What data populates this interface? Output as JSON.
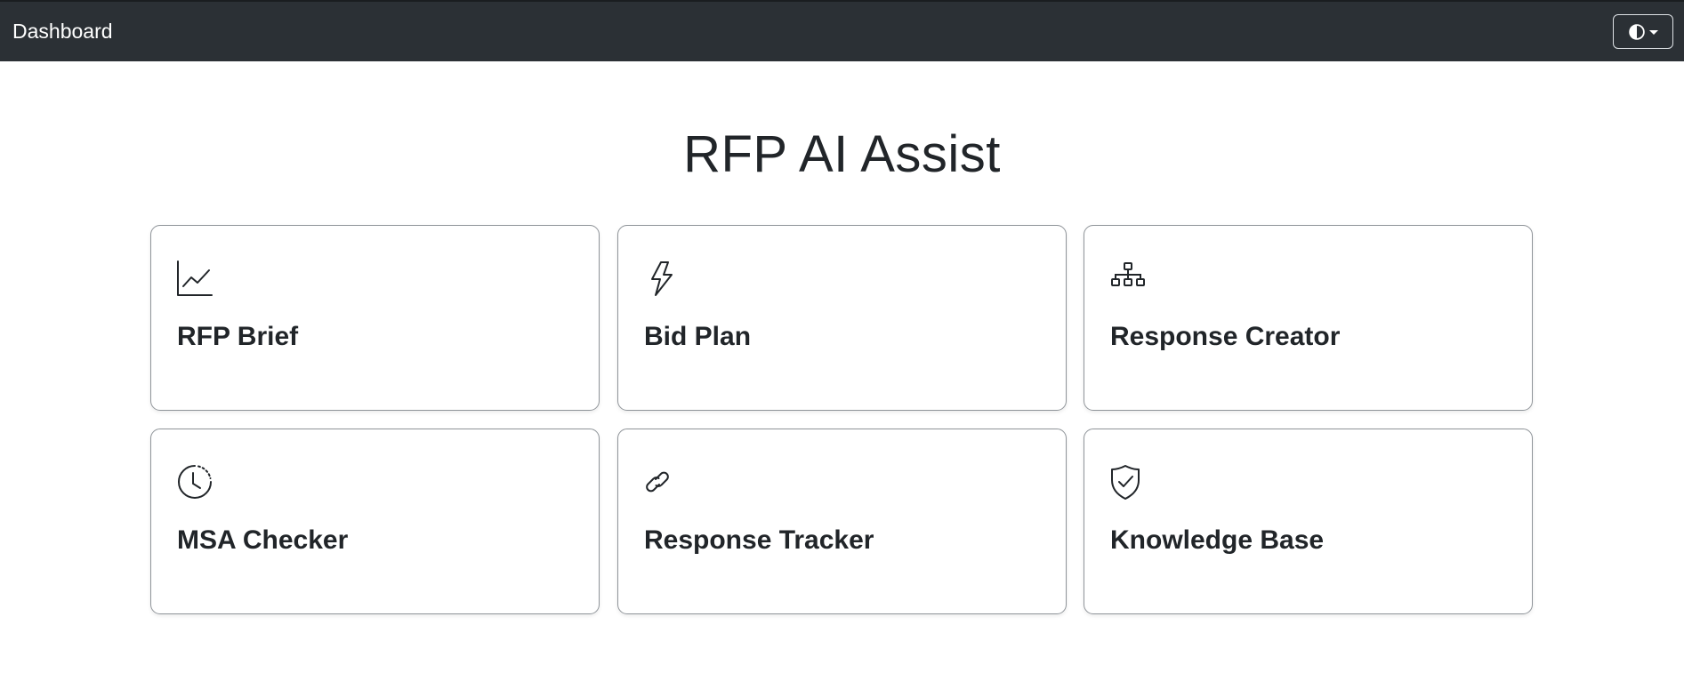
{
  "navbar": {
    "brand": "Dashboard",
    "theme_toggle_icon": "contrast-icon"
  },
  "page": {
    "title": "RFP AI Assist"
  },
  "cards": [
    {
      "label": "RFP Brief",
      "icon": "line-chart-icon"
    },
    {
      "label": "Bid Plan",
      "icon": "lightning-icon"
    },
    {
      "label": "Response Creator",
      "icon": "diagram-icon"
    },
    {
      "label": "MSA Checker",
      "icon": "clock-history-icon"
    },
    {
      "label": "Response Tracker",
      "icon": "link-icon"
    },
    {
      "label": "Knowledge Base",
      "icon": "shield-check-icon"
    }
  ],
  "colors": {
    "navbar_bg": "#2b3035",
    "text": "#212529",
    "card_border": "#8f9499"
  }
}
